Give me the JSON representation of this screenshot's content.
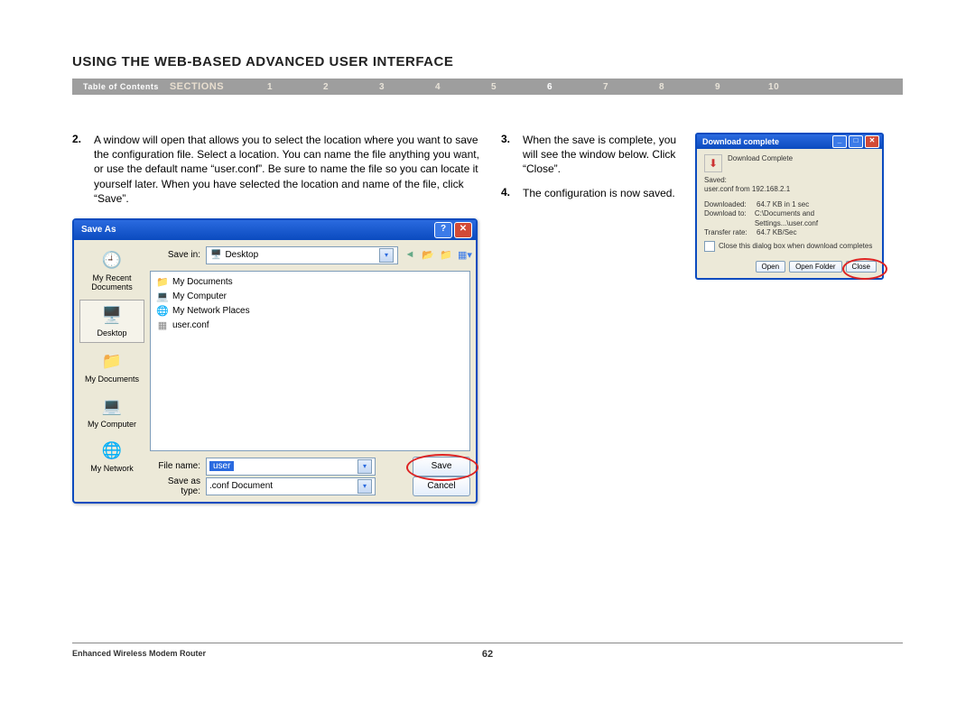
{
  "heading": "USING THE WEB-BASED ADVANCED USER INTERFACE",
  "nav": {
    "toc": "Table of Contents",
    "sections_label": "SECTIONS",
    "items": [
      "1",
      "2",
      "3",
      "4",
      "5",
      "6",
      "7",
      "8",
      "9",
      "10"
    ],
    "active_index": 5
  },
  "steps_left": {
    "num": "2.",
    "text": "A window will open that allows you to select the location where you want to save the configuration file. Select a location. You can name the file anything you want, or use the default name “user.conf”. Be sure to name the file so you can locate it yourself later. When you have selected the location and name of the file, click “Save”."
  },
  "steps_mid": {
    "s3_num": "3.",
    "s3_text": "When the save is complete, you will see the window below. Click “Close”.",
    "s4_num": "4.",
    "s4_text": "The configuration is now saved."
  },
  "save_dialog": {
    "title": "Save As",
    "help_btn": "?",
    "close_btn": "✕",
    "save_in_label": "Save in:",
    "save_in_value": "Desktop",
    "places": [
      "My Recent Documents",
      "Desktop",
      "My Documents",
      "My Computer",
      "My Network"
    ],
    "file_list": [
      "My Documents",
      "My Computer",
      "My Network Places",
      "user.conf"
    ],
    "file_name_label": "File name:",
    "file_name_value": "user",
    "save_type_label": "Save as type:",
    "save_type_value": ".conf Document",
    "save_btn": "Save",
    "cancel_btn": "Cancel"
  },
  "download_dialog": {
    "title": "Download complete",
    "header": "Download Complete",
    "saved_label": "Saved:",
    "saved_value": "user.conf from 192.168.2.1",
    "dl_label": "Downloaded:",
    "dl_value": "64.7 KB in 1 sec",
    "to_label": "Download to:",
    "to_value": "C:\\Documents and Settings...\\user.conf",
    "rate_label": "Transfer rate:",
    "rate_value": "64.7 KB/Sec",
    "checkbox_label": "Close this dialog box when download completes",
    "open_btn": "Open",
    "open_folder_btn": "Open Folder",
    "close_btn": "Close"
  },
  "footer": {
    "left": "Enhanced Wireless Modem Router",
    "page": "62"
  }
}
